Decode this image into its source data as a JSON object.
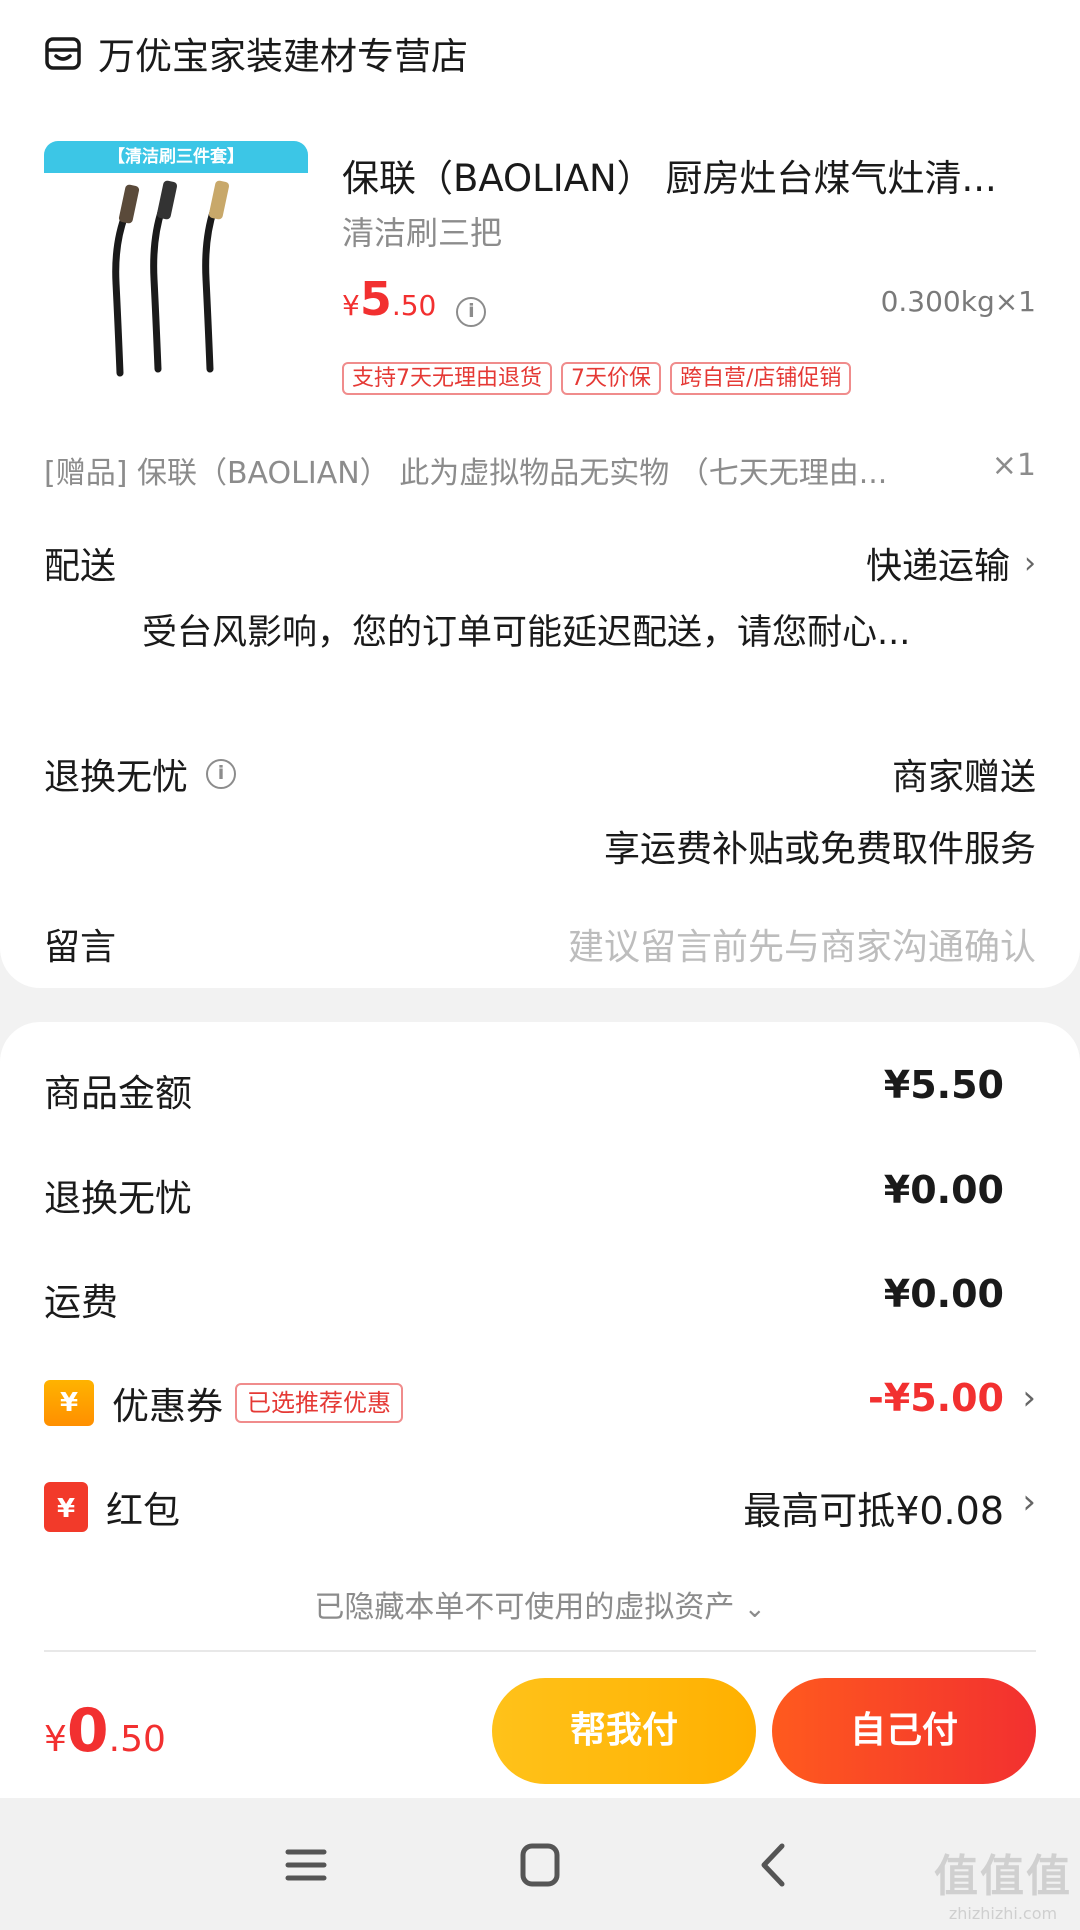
{
  "store": {
    "name": "万优宝家装建材专营店",
    "icon": "store-icon"
  },
  "product": {
    "banner": "【清洁刷三件套】",
    "title": "保联（BAOLIAN） 厨房灶台煤气灶清...",
    "spec": "清洁刷三把",
    "price_currency": "¥",
    "price_int": "5",
    "price_dec": ".50",
    "weight_qty": "0.300kg×1",
    "tags": [
      "支持7天无理由退货",
      "7天价保",
      "跨自营/店铺促销"
    ]
  },
  "gift": {
    "text": "[赠品] 保联（BAOLIAN） 此为虚拟物品无实物 （七天无理由...",
    "qty": "×1"
  },
  "delivery": {
    "label": "配送",
    "value": "快递运输",
    "notice": "受台风影响，您的订单可能延迟配送，请您耐心..."
  },
  "return_service": {
    "label": "退换无忧",
    "value": "商家赠送",
    "sub": "享运费补贴或免费取件服务"
  },
  "message": {
    "label": "留言",
    "placeholder": "建议留言前先与商家沟通确认"
  },
  "summary": {
    "goods_amount_label": "商品金额",
    "goods_amount": "¥5.50",
    "return_label": "退换无忧",
    "return_amount": "¥0.00",
    "shipping_label": "运费",
    "shipping_amount": "¥0.00",
    "coupon_label": "优惠券",
    "coupon_badge": "已选推荐优惠",
    "coupon_amount": "-¥5.00",
    "redpacket_label": "红包",
    "redpacket_amount": "最高可抵¥0.08",
    "hidden_note": "已隐藏本单不可使用的虚拟资产"
  },
  "footer": {
    "total_currency": "¥",
    "total_int": "0",
    "total_dec": ".50",
    "help_pay": "帮我付",
    "self_pay": "自己付"
  },
  "watermark": {
    "big": "值值值",
    "small": "zhizhizhi.com"
  },
  "colors": {
    "accent_red": "#f23030",
    "help_button": "#ffc21a",
    "self_button": "#ff5a1e"
  }
}
